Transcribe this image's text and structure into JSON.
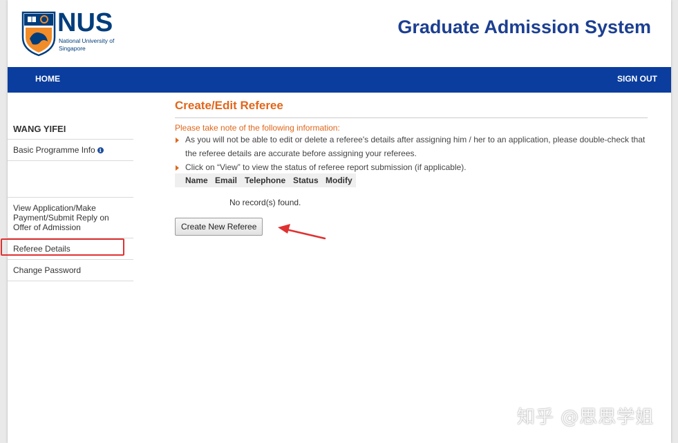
{
  "header": {
    "logo_text": "NUS",
    "logo_subtitle": "National University of Singapore",
    "system_title": "Graduate Admission System"
  },
  "nav": {
    "home": "HOME",
    "sign_out": "SIGN OUT"
  },
  "sidebar": {
    "user_name": "WANG YIFEI",
    "items": [
      {
        "label": "Basic Programme Info",
        "icon": "info-icon"
      },
      {
        "label": "View Application/Make Payment/Submit Reply on Offer of Admission"
      },
      {
        "label": "Referee Details",
        "highlighted": true
      },
      {
        "label": "Change Password"
      }
    ]
  },
  "main": {
    "title": "Create/Edit Referee",
    "note_heading": "Please take note of the following information:",
    "notes": [
      "As you will not be able to edit or delete a referee's details after assigning him / her to an application, please double-check that the referee details are accurate before assigning your referees.",
      "Click on “View” to view the status of referee report submission (if applicable)."
    ],
    "table": {
      "columns": [
        "Name",
        "Email",
        "Telephone",
        "Status",
        "Modify"
      ],
      "empty_message": "No record(s) found."
    },
    "create_button": "Create New Referee"
  },
  "watermark": "知乎 @思思学姐",
  "colors": {
    "brand_blue": "#003d7c",
    "nav_blue": "#0a3d9e",
    "accent_orange": "#e0661a",
    "highlight_red": "#e03030"
  }
}
